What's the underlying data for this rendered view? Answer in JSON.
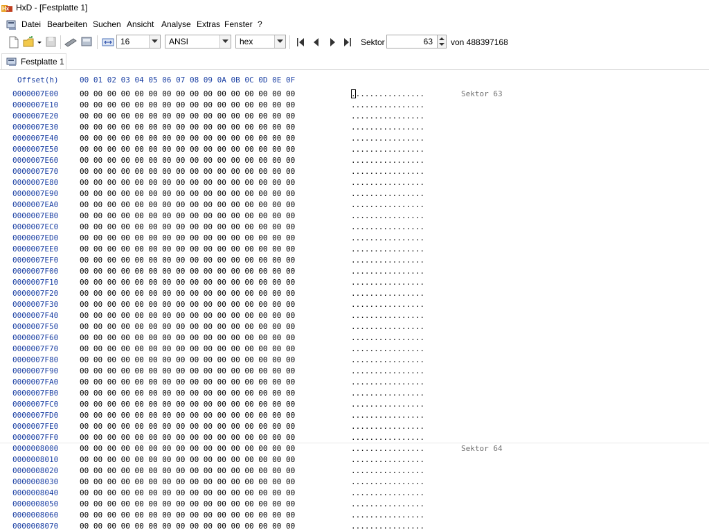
{
  "window": {
    "title": "HxD - [Festplatte 1]"
  },
  "menu": [
    "Datei",
    "Bearbeiten",
    "Suchen",
    "Ansicht",
    "Analyse",
    "Extras",
    "Fenster",
    "?"
  ],
  "toolbar": {
    "bytes_per_row": "16",
    "charset": "ANSI",
    "offset_base": "hex",
    "sector_label": "Sektor",
    "sector_value": "63",
    "sector_total": "von 488397168"
  },
  "tab": {
    "label": "Festplatte 1"
  },
  "hex": {
    "header_offset": "Offset(h)",
    "header_bytes": "00 01 02 03 04 05 06 07 08 09 0A 0B 0C 0D 0E 0F",
    "byte_row": "00 00 00 00 00 00 00 00 00 00 00 00 00 00 00 00",
    "ascii_row": "................",
    "sectors": [
      {
        "label": "Sektor 63",
        "offsets": [
          "0000007E00",
          "0000007E10",
          "0000007E20",
          "0000007E30",
          "0000007E40",
          "0000007E50",
          "0000007E60",
          "0000007E70",
          "0000007E80",
          "0000007E90",
          "0000007EA0",
          "0000007EB0",
          "0000007EC0",
          "0000007ED0",
          "0000007EE0",
          "0000007EF0",
          "0000007F00",
          "0000007F10",
          "0000007F20",
          "0000007F30",
          "0000007F40",
          "0000007F50",
          "0000007F60",
          "0000007F70",
          "0000007F80",
          "0000007F90",
          "0000007FA0",
          "0000007FB0",
          "0000007FC0",
          "0000007FD0",
          "0000007FE0",
          "0000007FF0"
        ]
      },
      {
        "label": "Sektor 64",
        "offsets": [
          "0000008000",
          "0000008010",
          "0000008020",
          "0000008030",
          "0000008040",
          "0000008050",
          "0000008060",
          "0000008070"
        ]
      }
    ]
  },
  "colors": {
    "offset_blue": "#1a3fa3",
    "sector_gray": "#707070"
  }
}
